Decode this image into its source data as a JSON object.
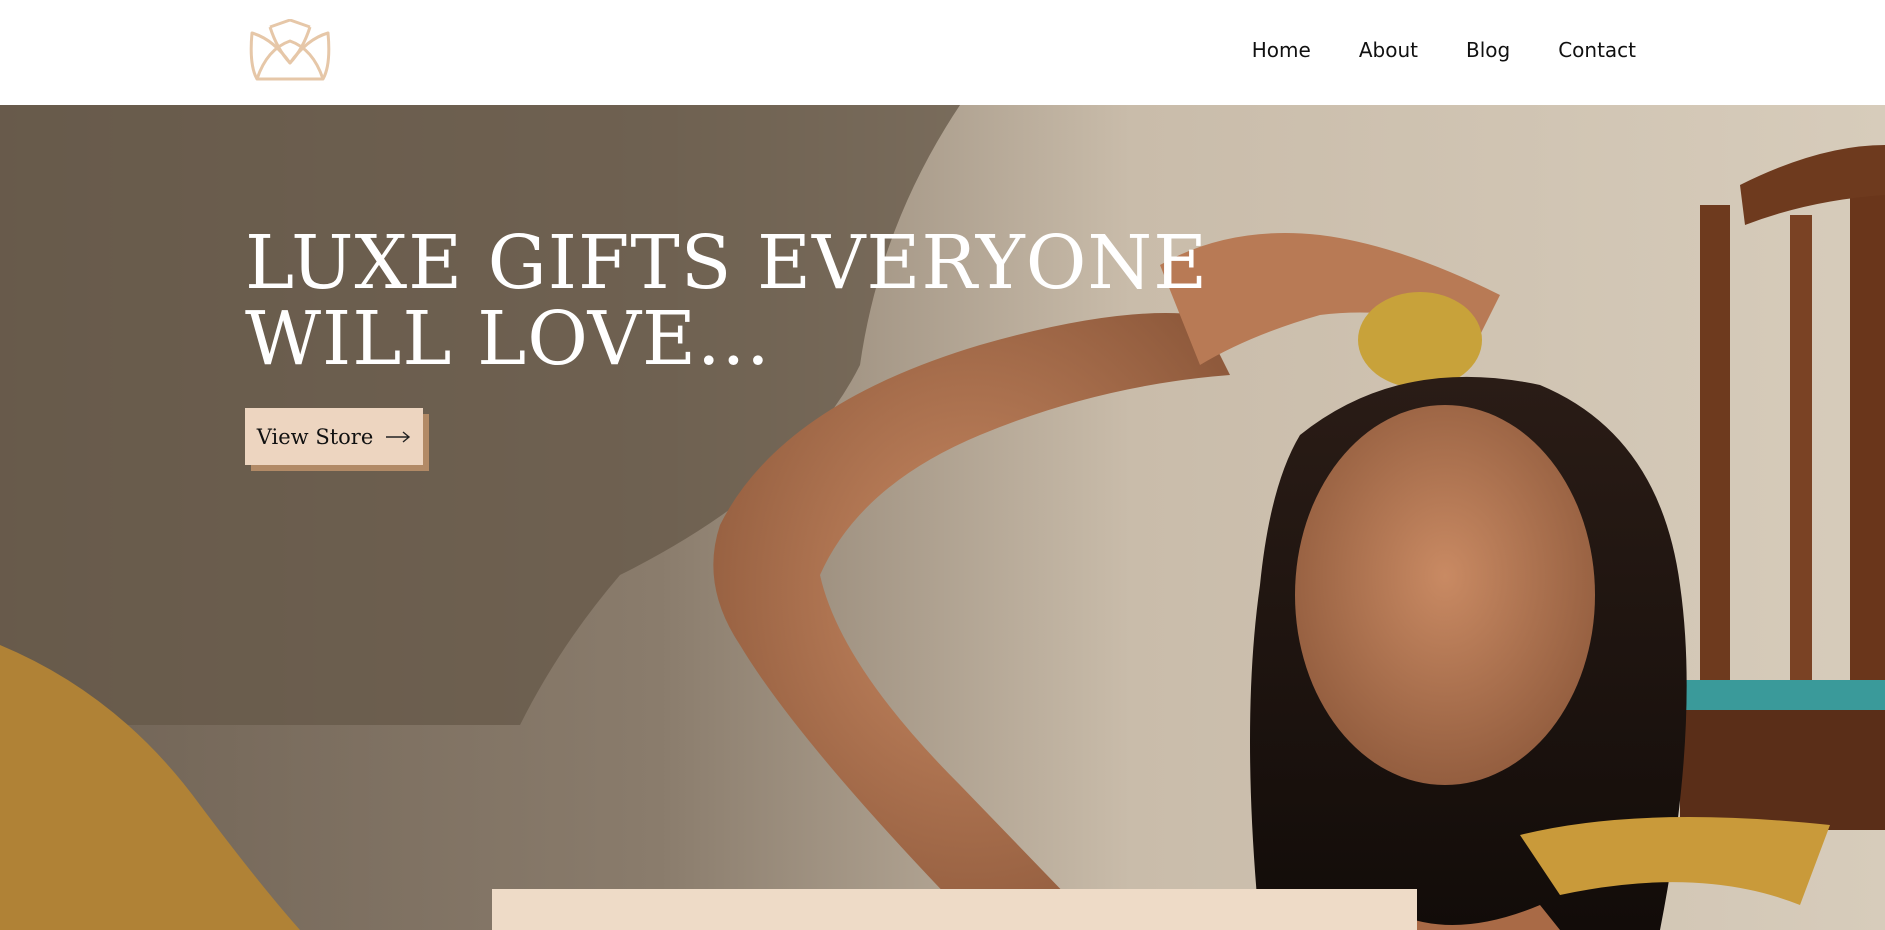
{
  "header": {
    "logo_icon": "lotus-icon",
    "nav": [
      {
        "label": "Home"
      },
      {
        "label": "About"
      },
      {
        "label": "Blog"
      },
      {
        "label": "Contact"
      }
    ]
  },
  "hero": {
    "title_line1": "LUXE GIFTS EVERYONE",
    "title_line2": "WILL LOVE...",
    "cta_label": "View Store",
    "cta_icon": "arrow-right-icon"
  },
  "colors": {
    "accent": "#edd5c0",
    "accent_shadow": "#b28a66",
    "logo": "#e6c7a8",
    "panel": "#eedbc7"
  }
}
